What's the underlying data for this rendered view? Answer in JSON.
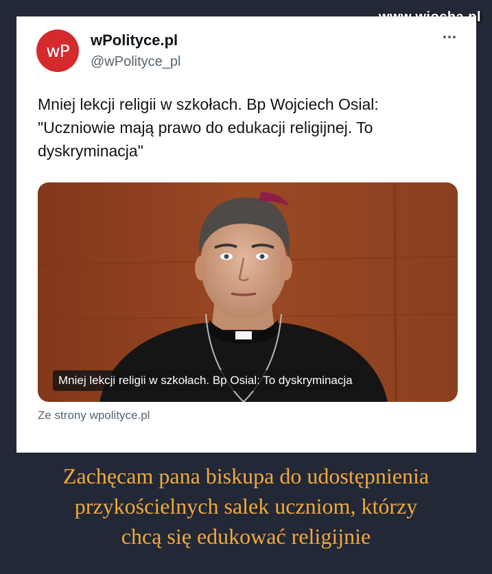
{
  "watermark": "www.wiocha.pl",
  "tweet": {
    "avatar_text": "wP",
    "display_name": "wPolityce.pl",
    "handle": "@wPolityce_pl",
    "more_icon": "more-horizontal-icon",
    "text": "Mniej lekcji religii w szkołach. Bp Wojciech Osial:\n\"Uczniowie mają prawo do edukacji religijnej. To\ndyskryminacja\"",
    "media_caption": "Mniej lekcji religii w szkołach. Bp Osial: To dyskryminacja",
    "source": "Ze strony wpolityce.pl"
  },
  "caption": "Zachęcam pana biskupa do udostępnienia\nprzykościelnych salek uczniom, którzy\nchcą się edukować religijnie",
  "colors": {
    "background": "#222836",
    "card": "#ffffff",
    "avatar": "#d42a2e",
    "caption": "#f2a93b",
    "secondary_text": "#536471"
  }
}
